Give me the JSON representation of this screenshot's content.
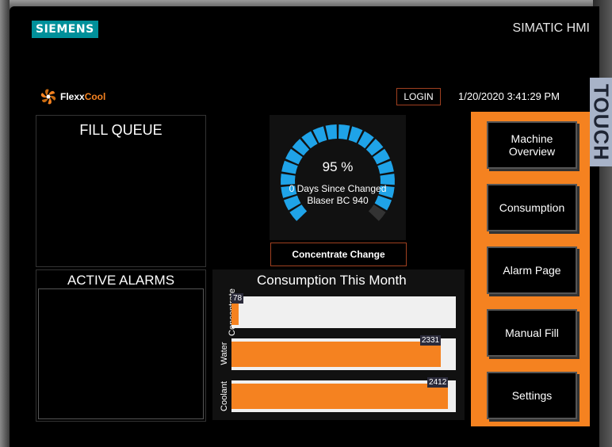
{
  "header": {
    "brand": "SIEMENS",
    "device": "SIMATIC HMI",
    "touch_label": "TOUCH"
  },
  "app": {
    "logo_flexx": "Flexx",
    "logo_cool": "Cool",
    "login_label": "LOGIN",
    "datetime": "1/20/2020 3:41:29 PM"
  },
  "fill_queue": {
    "title": "FILL QUEUE"
  },
  "active_alarms": {
    "title": "ACTIVE ALARMS"
  },
  "gauge": {
    "percent_text": "95 %",
    "percent_value": 95,
    "days_text": "0 Days Since Changed",
    "product": "Blaser BC 940",
    "button_label": "Concentrate Change"
  },
  "consumption": {
    "title": "Consumption This Month",
    "max": 2500,
    "bars": [
      {
        "label": "Concentrate",
        "value": 78,
        "value_text": "78"
      },
      {
        "label": "Water",
        "value": 2331,
        "value_text": "2331"
      },
      {
        "label": "Coolant",
        "value": 2412,
        "value_text": "2412"
      }
    ]
  },
  "nav": {
    "items": [
      {
        "label": "Machine Overview"
      },
      {
        "label": "Consumption"
      },
      {
        "label": "Alarm Page"
      },
      {
        "label": "Manual Fill"
      },
      {
        "label": "Settings"
      }
    ]
  },
  "colors": {
    "accent": "#f58220",
    "gauge": "#1fa3e8",
    "brand": "#00909a"
  }
}
